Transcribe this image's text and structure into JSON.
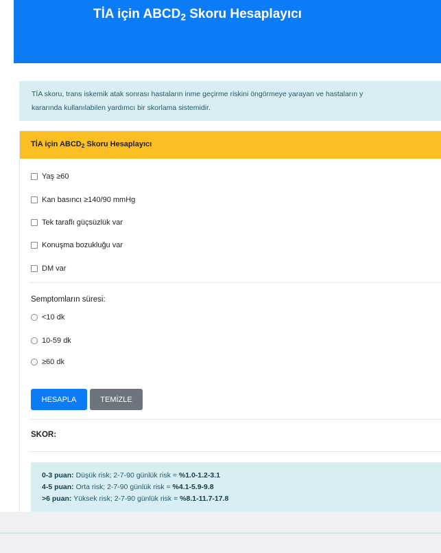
{
  "header": {
    "title_prefix": "TİA için ABCD",
    "title_sub": "2",
    "title_suffix": " Skoru Hesaplayıcı"
  },
  "info": {
    "line1": "TİA skoru, trans iskemik atak sonrası hastaların inme geçirme riskini öngörmeye yarayan ve hastaların y",
    "line2": "kararında kullanılabilen yardımcı bir skorlama sistemidir."
  },
  "card": {
    "header_prefix": "TİA için ABCD",
    "header_sub": "2",
    "header_suffix": " Skoru Hesaplayıcı",
    "checkboxes": [
      {
        "label": "Yaş ≥60"
      },
      {
        "label": "Kan basıncı ≥140/90 mmHg"
      },
      {
        "label": "Tek taraflı güçsüzlük var"
      },
      {
        "label": "Konuşma bozukluğu var"
      },
      {
        "label": "DM var"
      }
    ],
    "duration_label": "Semptomların süresi:",
    "radios": [
      {
        "label": "<10 dk"
      },
      {
        "label": "10-59 dk"
      },
      {
        "label": "≥60 dk"
      }
    ],
    "calc_button": "HESAPLA",
    "clear_button": "TEMİZLE",
    "score_label": "SKOR:",
    "risks": [
      {
        "range": "0-3 puan:",
        "text": " Düşük risk; 2-7-90 günlük risk = ",
        "value": "%1.0-1.2-3.1"
      },
      {
        "range": "4-5 puan:",
        "text": " Orta risk; 2-7-90 günlük risk = ",
        "value": "%4.1-5.9-9.8"
      },
      {
        "range": ">6 puan:",
        "text": " Yüksek risk; 2-7-90 günlük risk = ",
        "value": "%8.1-11.7-17.8"
      }
    ]
  }
}
